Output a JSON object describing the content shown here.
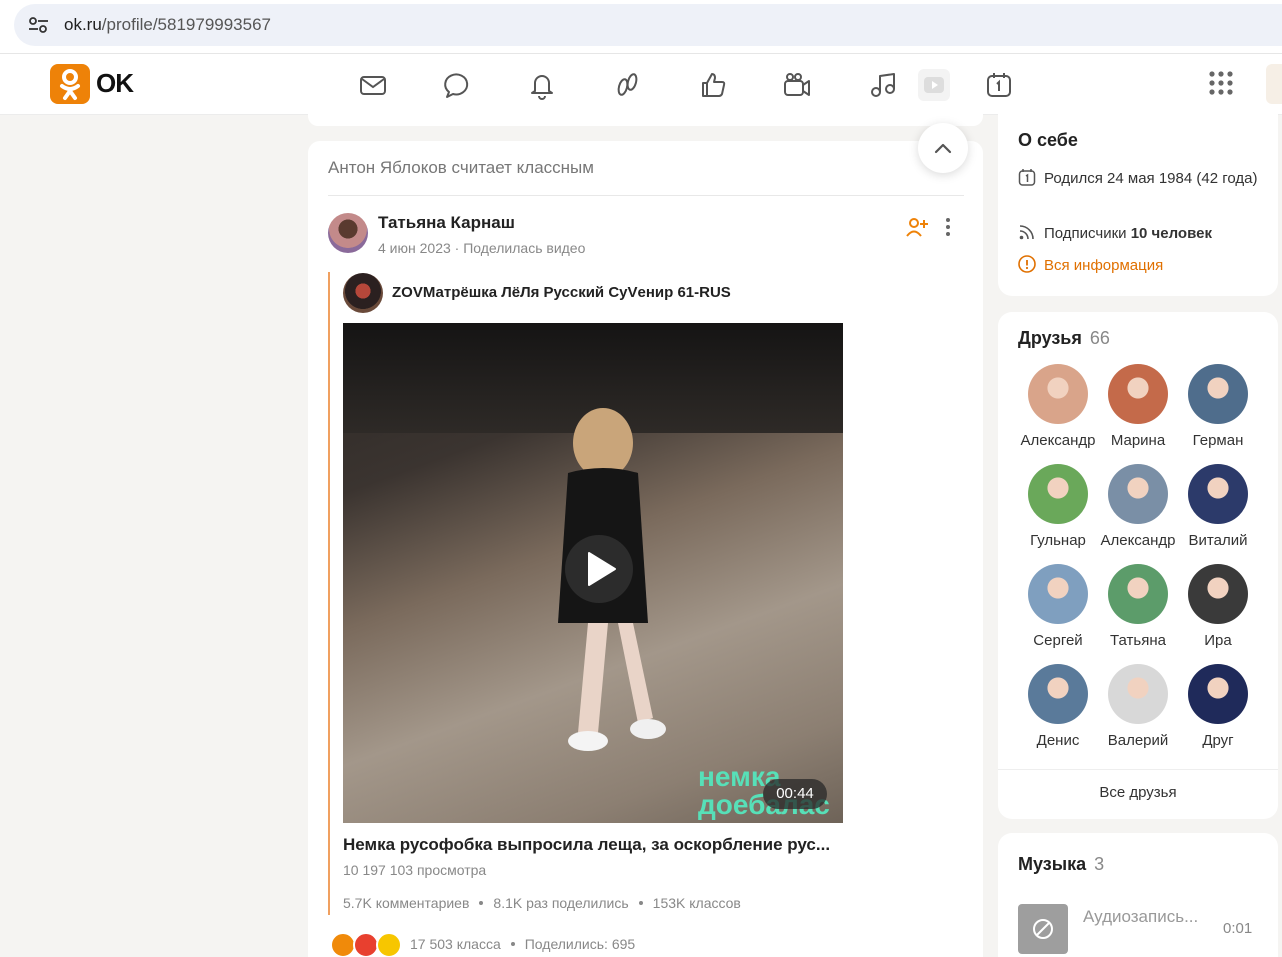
{
  "browser": {
    "url_domain": "ok.ru",
    "url_path": "/profile/581979993567"
  },
  "header": {
    "logo_text": "OK",
    "brand_color": "#ee8208",
    "nav_icons": [
      "mail-icon",
      "chat-icon",
      "bell-icon",
      "guests-icon",
      "likes-icon",
      "camera-icon",
      "music-icon",
      "video-icon",
      "calendar-icon"
    ],
    "apps_icon": "apps-grid-icon"
  },
  "feed": {
    "header": "Антон Яблоков считает классным",
    "post": {
      "author": "Татьяна Карнаш",
      "date": "4 июн 2023",
      "action": "Поделилась видео",
      "group_name": "ZOVМатрёшка ЛёЛя Русский СуVенир 61-RUS",
      "video": {
        "overlay_text": "немка\nдоебалас",
        "duration": "00:44",
        "title": "Немка русофобка выпросила леща, за оскорбление рус...",
        "views": "10 197 103 просмотра",
        "comments": "5.7K комментариев",
        "shares": "8.1K раз поделились",
        "likes": "153K классов"
      },
      "footer": {
        "likes": "17 503 класса",
        "shared": "Поделились: 695"
      }
    }
  },
  "about": {
    "title": "О себе",
    "birth": "Родился 24 мая 1984 (42 года)",
    "subscribers_label": "Подписчики",
    "subscribers_value": "10 человек",
    "all_info": "Вся информация"
  },
  "friends": {
    "title": "Друзья",
    "count": "66",
    "items": [
      {
        "name": "Александр",
        "color": "#d9a48a"
      },
      {
        "name": "Марина",
        "color": "#c46a4a"
      },
      {
        "name": "Герман",
        "color": "#4f6d8c"
      },
      {
        "name": "Гульнар",
        "color": "#6aa85a"
      },
      {
        "name": "Александр",
        "color": "#7a8fa6"
      },
      {
        "name": "Виталий",
        "color": "#2c3a6a"
      },
      {
        "name": "Сергей",
        "color": "#7f9fbf"
      },
      {
        "name": "Татьяна",
        "color": "#5c9c6a"
      },
      {
        "name": "Ира",
        "color": "#3a3a3a"
      },
      {
        "name": "Денис",
        "color": "#5a7a9a"
      },
      {
        "name": "Валерий",
        "color": "#d8d8d8"
      },
      {
        "name": "Друг",
        "color": "#1f2a5a"
      }
    ],
    "all_label": "Все друзья"
  },
  "music": {
    "title": "Музыка",
    "count": "3",
    "track_title": "Аудиозапись...",
    "track_time": "0:01"
  }
}
